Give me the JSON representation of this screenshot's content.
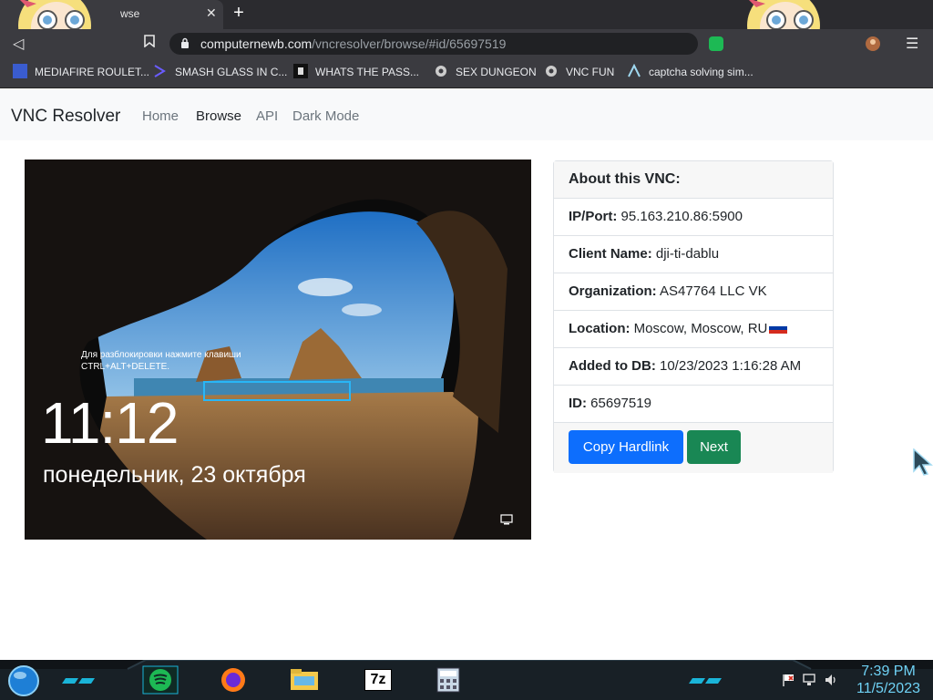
{
  "browser": {
    "tab_title": "wse",
    "url_host": "computernewb.com",
    "url_path": "/vncresolver/browse/#id/65697519",
    "bookmarks": [
      {
        "label": "MEDIAFIRE ROULET..."
      },
      {
        "label": "SMASH GLASS IN C..."
      },
      {
        "label": "WHATS THE PASS..."
      },
      {
        "label": "SEX DUNGEON"
      },
      {
        "label": "VNC FUN"
      },
      {
        "label": "captcha solving sim..."
      }
    ]
  },
  "site": {
    "brand": "VNC Resolver",
    "nav": [
      {
        "label": "Home"
      },
      {
        "label": "Browse"
      },
      {
        "label": "API"
      },
      {
        "label": "Dark Mode"
      }
    ]
  },
  "vnc_screenshot": {
    "unlock_hint_line1": "Для разблокировки нажмите клавиши",
    "unlock_hint_line2": "CTRL+ALT+DELETE.",
    "time": "11:12",
    "date": "понедельник, 23 октября"
  },
  "info": {
    "header": "About this VNC:",
    "rows": [
      {
        "label": "IP/Port:",
        "value": "95.163.210.86:5900"
      },
      {
        "label": "Client Name:",
        "value": "dji-ti-dablu"
      },
      {
        "label": "Organization:",
        "value": "AS47764 LLC VK"
      },
      {
        "label": "Location:",
        "value": "Moscow, Moscow, RU"
      },
      {
        "label": "Added to DB:",
        "value": "10/23/2023 1:16:28 AM"
      },
      {
        "label": "ID:",
        "value": "65697519"
      }
    ],
    "copy_button": "Copy Hardlink",
    "next_button": "Next"
  },
  "taskbar": {
    "time": "7:39 PM",
    "date": "11/5/2023",
    "apps": [
      "spotify-icon",
      "firefox-icon",
      "file-explorer-icon",
      "7zip-icon",
      "calculator-icon"
    ],
    "tray_7z_label": "7z"
  },
  "colors": {
    "primary": "#0d6efd",
    "success": "#198754",
    "clock": "#6fd2f5"
  }
}
